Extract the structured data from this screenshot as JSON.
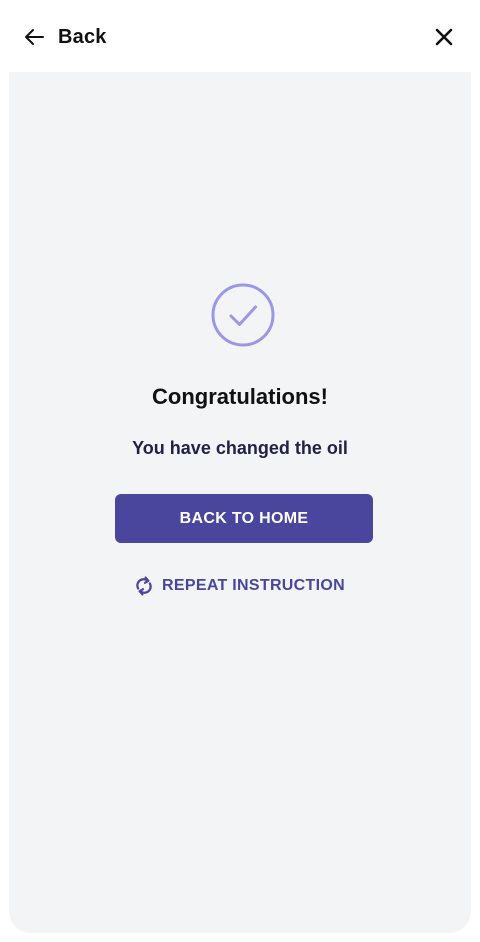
{
  "header": {
    "back_label": "Back",
    "back_icon": "arrow-left-icon",
    "close_icon": "close-icon"
  },
  "main": {
    "status_icon": "check-circle-icon",
    "title": "Congratulations!",
    "message": "You have changed the oil",
    "primary_button_label": "BACK TO HOME",
    "secondary_button_label": "REPEAT INSTRUCTION",
    "secondary_button_icon": "repeat-icon"
  },
  "colors": {
    "accent": "#4a469d",
    "check_icon": "#9a97e6",
    "card_background": "#f3f4f6",
    "page_background": "#ffffff",
    "title_text": "#111111",
    "message_text": "#22214a"
  }
}
